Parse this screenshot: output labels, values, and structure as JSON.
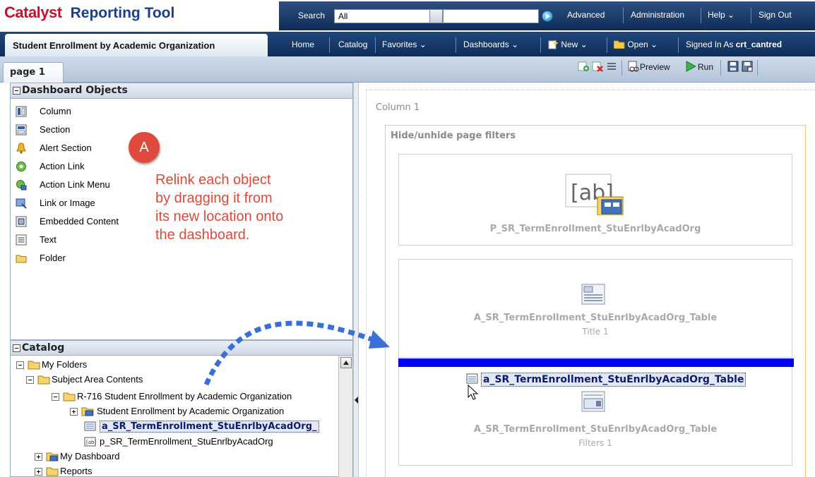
{
  "app": {
    "brand_prefix": "Catalyst",
    "brand_name": "Reporting Tool"
  },
  "globalbar": {
    "search_label": "Search",
    "search_scope": "All",
    "links": [
      "Advanced",
      "Administration",
      "Help",
      "Sign Out"
    ]
  },
  "navbar": {
    "dashboard_title": "Student Enrollment by Academic Organization",
    "links": [
      "Home",
      "Catalog",
      "Favorites",
      "Dashboards",
      "New",
      "Open"
    ],
    "signed_in_label": "Signed In As",
    "signed_in_user": "crt_cantred"
  },
  "pagebar": {
    "page_tab": "page 1",
    "preview_label": "Preview",
    "run_label": "Run"
  },
  "objects_panel": {
    "title": "Dashboard Objects",
    "items": [
      {
        "label": "Column",
        "icon": "column-icon"
      },
      {
        "label": "Section",
        "icon": "section-icon"
      },
      {
        "label": "Alert Section",
        "icon": "bell-icon"
      },
      {
        "label": "Action Link",
        "icon": "action-link-icon"
      },
      {
        "label": "Action Link Menu",
        "icon": "action-link-menu-icon"
      },
      {
        "label": "Link or Image",
        "icon": "link-image-icon"
      },
      {
        "label": "Embedded Content",
        "icon": "embedded-content-icon"
      },
      {
        "label": "Text",
        "icon": "text-icon"
      },
      {
        "label": "Folder",
        "icon": "folder-icon"
      }
    ]
  },
  "catalog_panel": {
    "title": "Catalog",
    "items": [
      {
        "label": "My Folders"
      },
      {
        "label": "Subject Area Contents"
      },
      {
        "label": "R-716 Student Enrollment by Academic Organization"
      },
      {
        "label": "Student Enrollment by Academic Organization"
      },
      {
        "label": "a_SR_TermEnrollment_StuEnrlbyAcadOrg_"
      },
      {
        "label": "p_SR_TermEnrollment_StuEnrlbyAcadOrg"
      },
      {
        "label": "My Dashboard"
      },
      {
        "label": "Reports"
      }
    ]
  },
  "canvas": {
    "column_label": "Column 1",
    "section_label": "Hide/unhide page filters",
    "cards": [
      {
        "name": "P_SR_TermEnrollment_StuEnrlbyAcadOrg",
        "sub": ""
      },
      {
        "name": "A_SR_TermEnrollment_StuEnrlbyAcadOrg_Table",
        "sub": "Title 1"
      },
      {
        "name": "A_SR_TermEnrollment_StuEnrlbyAcadOrg_Table",
        "sub": "Filters 1"
      }
    ],
    "drag_label": "a_SR_TermEnrollment_StuEnrlbyAcadOrg_Table",
    "prompt_icon_text": "[ab]"
  },
  "annotation": {
    "marker": "A",
    "lines": [
      "Relink each object",
      "by dragging it from",
      "its new location onto",
      "the dashboard."
    ]
  },
  "colors": {
    "brand_red": "#c8102e",
    "brand_blue": "#1b3f8b",
    "header_navy": "#0f2d58",
    "annotation_red": "#e04a3d",
    "drop_bar": "#0000f2",
    "drag_arrow": "#3a6fd8"
  }
}
